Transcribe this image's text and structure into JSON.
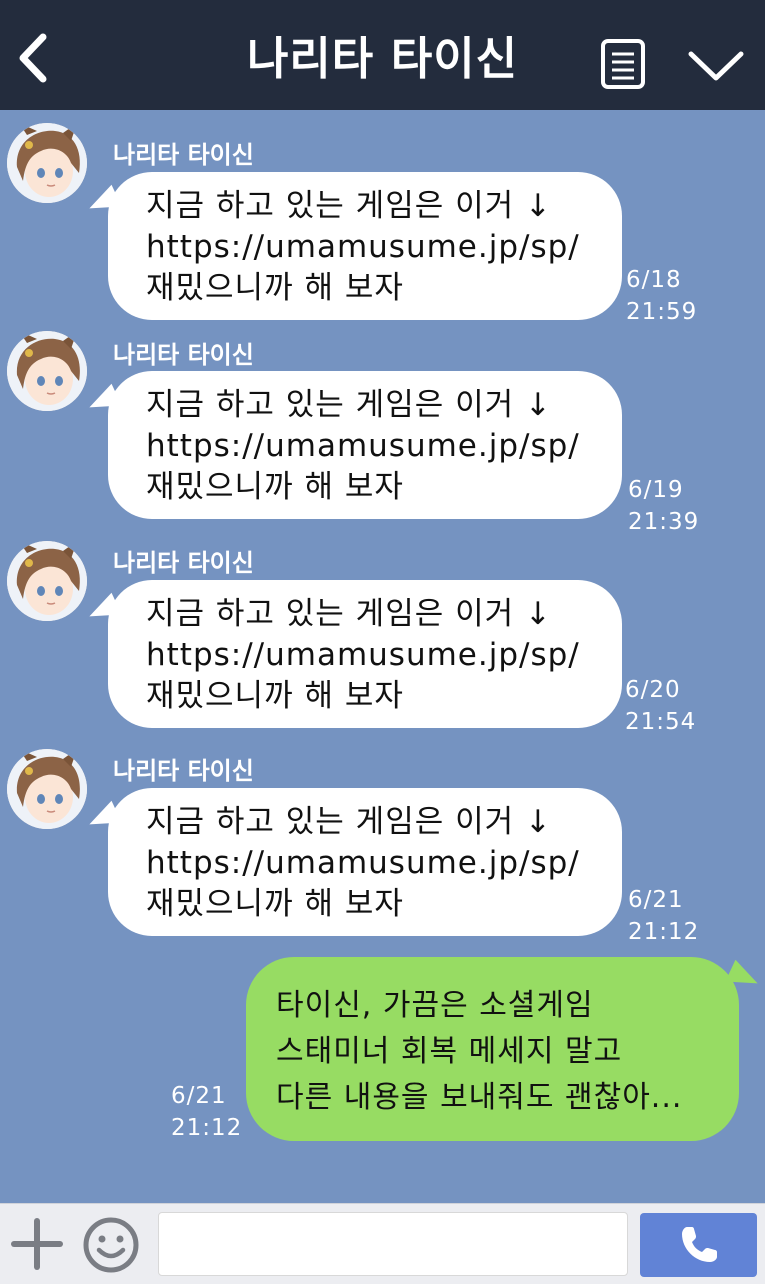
{
  "header": {
    "title": "나리타 타이신",
    "back_icon": "chevron-left-icon",
    "menu_icon": "document-list-icon",
    "collapse_icon": "chevron-down-icon"
  },
  "messages_in": [
    {
      "sender": "나리타 타이신",
      "lines": [
        "지금 하고 있는 게임은 이거 ↓",
        "https://umamusume.jp/sp/",
        "재밌으니까 해 보자"
      ],
      "date": "6/18",
      "time": "21:59"
    },
    {
      "sender": "나리타 타이신",
      "lines": [
        "지금 하고 있는 게임은 이거 ↓",
        "https://umamusume.jp/sp/",
        "재밌으니까 해 보자"
      ],
      "date": "6/19",
      "time": "21:39"
    },
    {
      "sender": "나리타 타이신",
      "lines": [
        "지금 하고 있는 게임은 이거 ↓",
        "https://umamusume.jp/sp/",
        "재밌으니까 해 보자"
      ],
      "date": "6/20",
      "time": "21:54"
    },
    {
      "sender": "나리타 타이신",
      "lines": [
        "지금 하고 있는 게임은 이거 ↓",
        "https://umamusume.jp/sp/",
        "재밌으니까 해 보자"
      ],
      "date": "6/21",
      "time": "21:12"
    }
  ],
  "message_out": {
    "lines": [
      "타이신, 가끔은 소셜게임",
      "스태미너 회복 메세지 말고",
      "다른 내용을 보내줘도 괜찮아..."
    ],
    "date": "6/21",
    "time": "21:12"
  },
  "input_bar": {
    "plus_icon": "plus-icon",
    "emoji_icon": "smiley-icon",
    "message_value": "",
    "send_icon": "phone-icon"
  },
  "colors": {
    "header_bg": "#232c3d",
    "chat_bg": "#7593c1",
    "incoming_bubble": "#ffffff",
    "outgoing_bubble": "#97dc63",
    "send_button": "#6183d6"
  }
}
